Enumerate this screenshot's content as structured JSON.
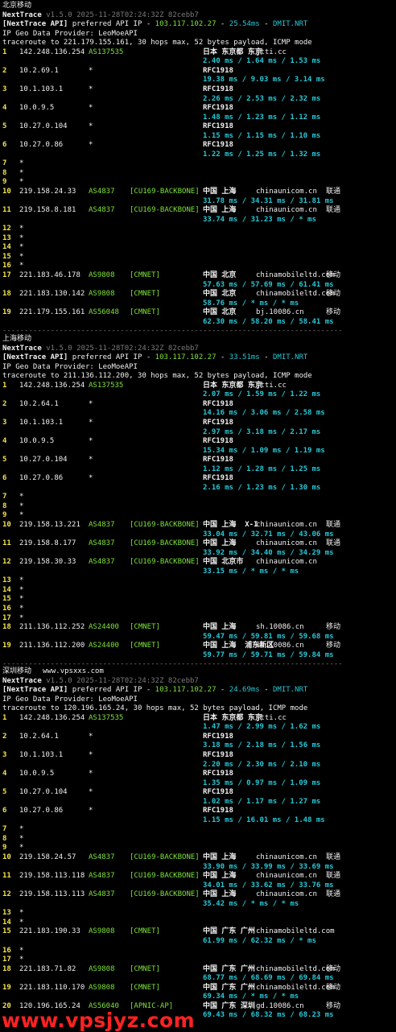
{
  "sections": [
    {
      "title": "北京移动",
      "title_extra": "",
      "header": {
        "tool": "NextTrace",
        "version_line": " v1.5.0 2025-11-28T02:24:32Z 82cebb7",
        "api_prefix": "[NextTrace API]",
        "api_mid": " preferred API IP - ",
        "api_ip": "103.117.102.27",
        "api_dash": " - ",
        "api_ms": "25.54ms",
        "api_dash2": " - ",
        "api_node": "DMIT.NRT",
        "geo": "IP Geo Data Provider: LeoMoeAPI",
        "trace": "traceroute to 221.179.155.161, 30 hops max, 52 bytes payload, ICMP mode"
      },
      "hops": [
        {
          "n": "1",
          "ip": "142.248.136.254",
          "asn": "AS137535",
          "tag": "",
          "geo": "日本 东京都 东京",
          "dom": "jtti.cc",
          "isp": "",
          "rtt": "2.40 ms / 1.64 ms / 1.53 ms"
        },
        {
          "n": "2",
          "ip": "10.2.69.1",
          "asn": "*",
          "tag": "",
          "geo": "RFC1918",
          "dom": "",
          "isp": "",
          "rtt": "19.38 ms / 9.03 ms / 3.14 ms"
        },
        {
          "n": "3",
          "ip": "10.1.103.1",
          "asn": "*",
          "tag": "",
          "geo": "RFC1918",
          "dom": "",
          "isp": "",
          "rtt": "2.26 ms / 2.53 ms / 2.32 ms"
        },
        {
          "n": "4",
          "ip": "10.0.9.5",
          "asn": "*",
          "tag": "",
          "geo": "RFC1918",
          "dom": "",
          "isp": "",
          "rtt": "1.48 ms / 1.23 ms / 1.12 ms"
        },
        {
          "n": "5",
          "ip": "10.27.0.104",
          "asn": "*",
          "tag": "",
          "geo": "RFC1918",
          "dom": "",
          "isp": "",
          "rtt": "1.15 ms / 1.15 ms / 1.10 ms"
        },
        {
          "n": "6",
          "ip": "10.27.0.86",
          "asn": "*",
          "tag": "",
          "geo": "RFC1918",
          "dom": "",
          "isp": "",
          "rtt": "1.22 ms / 1.25 ms / 1.32 ms"
        },
        {
          "n": "7",
          "star": true
        },
        {
          "n": "8",
          "star": true
        },
        {
          "n": "9",
          "star": true
        },
        {
          "n": "10",
          "ip": "219.158.24.33",
          "asn": "AS4837",
          "tag": "[CU169-BACKBONE]",
          "geo": "中国 上海",
          "dom": "chinaunicom.cn",
          "isp": "联通",
          "rtt": "31.78 ms / 34.31 ms / 31.81 ms"
        },
        {
          "n": "11",
          "ip": "219.158.8.181",
          "asn": "AS4837",
          "tag": "[CU169-BACKBONE]",
          "geo": "中国 上海",
          "dom": "chinaunicom.cn",
          "isp": "联通",
          "rtt": "33.74 ms / 31.23 ms / * ms"
        },
        {
          "n": "12",
          "star": true
        },
        {
          "n": "13",
          "star": true
        },
        {
          "n": "14",
          "star": true
        },
        {
          "n": "15",
          "star": true
        },
        {
          "n": "16",
          "star": true
        },
        {
          "n": "17",
          "ip": "221.183.46.178",
          "asn": "AS9808",
          "tag": "[CMNET]",
          "geo": "中国 北京",
          "dom": "chinamobileltd.com",
          "isp": "移动",
          "rtt": "57.63 ms / 57.69 ms / 61.41 ms"
        },
        {
          "n": "18",
          "ip": "221.183.130.142",
          "asn": "AS9808",
          "tag": "[CMNET]",
          "geo": "中国 北京",
          "dom": "chinamobileltd.com",
          "isp": "移动",
          "rtt": "58.76 ms / * ms / * ms"
        },
        {
          "n": "19",
          "ip": "221.179.155.161",
          "asn": "AS56048",
          "tag": "[CMNET]",
          "geo": "中国 北京",
          "dom": "bj.10086.cn",
          "isp": "移动",
          "rtt": "62.30 ms / 58.20 ms / 58.41 ms"
        }
      ]
    },
    {
      "title": "上海移动",
      "title_extra": "",
      "header": {
        "tool": "NextTrace",
        "version_line": " v1.5.0 2025-11-28T02:24:32Z 82cebb7",
        "api_prefix": "[NextTrace API]",
        "api_mid": " preferred API IP - ",
        "api_ip": "103.117.102.27",
        "api_dash": " - ",
        "api_ms": "33.51ms",
        "api_dash2": " - ",
        "api_node": "DMIT.NRT",
        "geo": "IP Geo Data Provider: LeoMoeAPI",
        "trace": "traceroute to 211.136.112.200, 30 hops max, 52 bytes payload, ICMP mode"
      },
      "hops": [
        {
          "n": "1",
          "ip": "142.248.136.254",
          "asn": "AS137535",
          "tag": "",
          "geo": "日本 东京都 东京",
          "dom": "jtti.cc",
          "isp": "",
          "rtt": "2.07 ms / 1.59 ms / 1.22 ms"
        },
        {
          "n": "2",
          "ip": "10.2.64.1",
          "asn": "*",
          "tag": "",
          "geo": "RFC1918",
          "dom": "",
          "isp": "",
          "rtt": "14.16 ms / 3.06 ms / 2.58 ms"
        },
        {
          "n": "3",
          "ip": "10.1.103.1",
          "asn": "*",
          "tag": "",
          "geo": "RFC1918",
          "dom": "",
          "isp": "",
          "rtt": "2.97 ms / 3.18 ms / 2.17 ms"
        },
        {
          "n": "4",
          "ip": "10.0.9.5",
          "asn": "*",
          "tag": "",
          "geo": "RFC1918",
          "dom": "",
          "isp": "",
          "rtt": "15.34 ms / 1.09 ms / 1.19 ms"
        },
        {
          "n": "5",
          "ip": "10.27.0.104",
          "asn": "*",
          "tag": "",
          "geo": "RFC1918",
          "dom": "",
          "isp": "",
          "rtt": "1.12 ms / 1.28 ms / 1.25 ms"
        },
        {
          "n": "6",
          "ip": "10.27.0.86",
          "asn": "*",
          "tag": "",
          "geo": "RFC1918",
          "dom": "",
          "isp": "",
          "rtt": "2.16 ms / 1.23 ms / 1.30 ms"
        },
        {
          "n": "7",
          "star": true
        },
        {
          "n": "8",
          "star": true
        },
        {
          "n": "9",
          "star": true
        },
        {
          "n": "10",
          "ip": "219.158.13.221",
          "asn": "AS4837",
          "tag": "[CU169-BACKBONE]",
          "geo": "中国 上海  X-I",
          "dom": "chinaunicom.cn",
          "isp": "联通",
          "rtt": "33.04 ms / 32.71 ms / 43.06 ms"
        },
        {
          "n": "11",
          "ip": "219.158.8.177",
          "asn": "AS4837",
          "tag": "[CU169-BACKBONE]",
          "geo": "中国 上海",
          "dom": "chinaunicom.cn",
          "isp": "联通",
          "rtt": "33.92 ms / 34.40 ms / 34.29 ms"
        },
        {
          "n": "12",
          "ip": "219.158.30.33",
          "asn": "AS4837",
          "tag": "[CU169-BACKBONE]",
          "geo": "中国 北京市",
          "dom": "chinaunicom.cn",
          "isp": "",
          "rtt": "33.15 ms / * ms / * ms"
        },
        {
          "n": "13",
          "star": true
        },
        {
          "n": "14",
          "star": true
        },
        {
          "n": "15",
          "star": true
        },
        {
          "n": "16",
          "star": true
        },
        {
          "n": "17",
          "star": true
        },
        {
          "n": "18",
          "ip": "211.136.112.252",
          "asn": "AS24400",
          "tag": "[CMNET]",
          "geo": "中国 上海",
          "dom": "sh.10086.cn",
          "isp": "移动",
          "rtt": "59.47 ms / 59.81 ms / 59.68 ms"
        },
        {
          "n": "19",
          "ip": "211.136.112.200",
          "asn": "AS24400",
          "tag": "[CMNET]",
          "geo": "中国 上海  浦东新区",
          "dom": "sh.10086.cn",
          "isp": "移动",
          "rtt": "59.77 ms / 59.71 ms / 59.84 ms"
        }
      ]
    },
    {
      "title": "深圳移动",
      "title_extra": "www.vpsxxs.com",
      "header": {
        "tool": "NextTrace",
        "version_line": " v1.5.0 2025-11-28T02:24:32Z 82cebb7",
        "api_prefix": "[NextTrace API]",
        "api_mid": " preferred API IP - ",
        "api_ip": "103.117.102.27",
        "api_dash": " - ",
        "api_ms": "24.69ms",
        "api_dash2": " - ",
        "api_node": "DMIT.NRT",
        "geo": "IP Geo Data Provider: LeoMoeAPI",
        "trace": "traceroute to 120.196.165.24, 30 hops max, 52 bytes payload, ICMP mode"
      },
      "hops": [
        {
          "n": "1",
          "ip": "142.248.136.254",
          "asn": "AS137535",
          "tag": "",
          "geo": "日本 东京都 东京",
          "dom": "jtti.cc",
          "isp": "",
          "rtt": "1.47 ms / 2.99 ms / 1.62 ms"
        },
        {
          "n": "2",
          "ip": "10.2.64.1",
          "asn": "*",
          "tag": "",
          "geo": "RFC1918",
          "dom": "",
          "isp": "",
          "rtt": "3.18 ms / 2.18 ms / 1.56 ms"
        },
        {
          "n": "3",
          "ip": "10.1.103.1",
          "asn": "*",
          "tag": "",
          "geo": "RFC1918",
          "dom": "",
          "isp": "",
          "rtt": "2.20 ms / 2.30 ms / 2.10 ms"
        },
        {
          "n": "4",
          "ip": "10.0.9.5",
          "asn": "*",
          "tag": "",
          "geo": "RFC1918",
          "dom": "",
          "isp": "",
          "rtt": "1.35 ms / 0.97 ms / 1.09 ms"
        },
        {
          "n": "5",
          "ip": "10.27.0.104",
          "asn": "*",
          "tag": "",
          "geo": "RFC1918",
          "dom": "",
          "isp": "",
          "rtt": "1.02 ms / 1.17 ms / 1.27 ms"
        },
        {
          "n": "6",
          "ip": "10.27.0.86",
          "asn": "*",
          "tag": "",
          "geo": "RFC1918",
          "dom": "",
          "isp": "",
          "rtt": "1.15 ms / 16.01 ms / 1.48 ms"
        },
        {
          "n": "7",
          "star": true
        },
        {
          "n": "8",
          "star": true
        },
        {
          "n": "9",
          "star": true
        },
        {
          "n": "10",
          "ip": "219.158.24.57",
          "asn": "AS4837",
          "tag": "[CU169-BACKBONE]",
          "geo": "中国 上海",
          "dom": "chinaunicom.cn",
          "isp": "联通",
          "rtt": "33.90 ms / 33.99 ms / 33.69 ms"
        },
        {
          "n": "11",
          "ip": "219.158.113.118",
          "asn": "AS4837",
          "tag": "[CU169-BACKBONE]",
          "geo": "中国 上海",
          "dom": "chinaunicom.cn",
          "isp": "联通",
          "rtt": "34.01 ms / 33.62 ms / 33.76 ms"
        },
        {
          "n": "12",
          "ip": "219.158.113.113",
          "asn": "AS4837",
          "tag": "[CU169-BACKBONE]",
          "geo": "中国 上海",
          "dom": "chinaunicom.cn",
          "isp": "联通",
          "rtt": "35.42 ms / * ms / * ms"
        },
        {
          "n": "13",
          "star": true
        },
        {
          "n": "14",
          "star": true
        },
        {
          "n": "15",
          "ip": "221.183.190.33",
          "asn": "AS9808",
          "tag": "[CMNET]",
          "geo": "中国 广东 广州",
          "dom": "chinamobileltd.com",
          "isp": "",
          "rtt": "61.99 ms / 62.32 ms / * ms"
        },
        {
          "n": "16",
          "star": true
        },
        {
          "n": "17",
          "star": true
        },
        {
          "n": "18",
          "ip": "221.183.71.82",
          "asn": "AS9808",
          "tag": "[CMNET]",
          "geo": "中国 广东 广州",
          "dom": "chinamobileltd.com",
          "isp": "移动",
          "rtt": "68.77 ms / 68.69 ms / 69.84 ms"
        },
        {
          "n": "19",
          "ip": "221.183.110.170",
          "asn": "AS9808",
          "tag": "[CMNET]",
          "geo": "中国 广东 广州",
          "dom": "chinamobileltd.com",
          "isp": "移动",
          "rtt": "69.34 ms / * ms / * ms"
        },
        {
          "n": "20",
          "ip": "120.196.165.24",
          "asn": "AS56040",
          "tag": "[APNIC-AP]",
          "geo": "中国 广东 深圳",
          "dom": "gd.10086.cn",
          "isp": "移动",
          "rtt": "69.43 ms / 68.32 ms / 68.23 ms"
        }
      ]
    }
  ],
  "separator": "------------------------------------------------------------------------------",
  "watermark": "www.vpsjyz.com",
  "colors": {
    "cyan": "#27c7d6",
    "green": "#7ee23a",
    "yellow": "#f2e14c",
    "watermark": "#ff2222"
  }
}
